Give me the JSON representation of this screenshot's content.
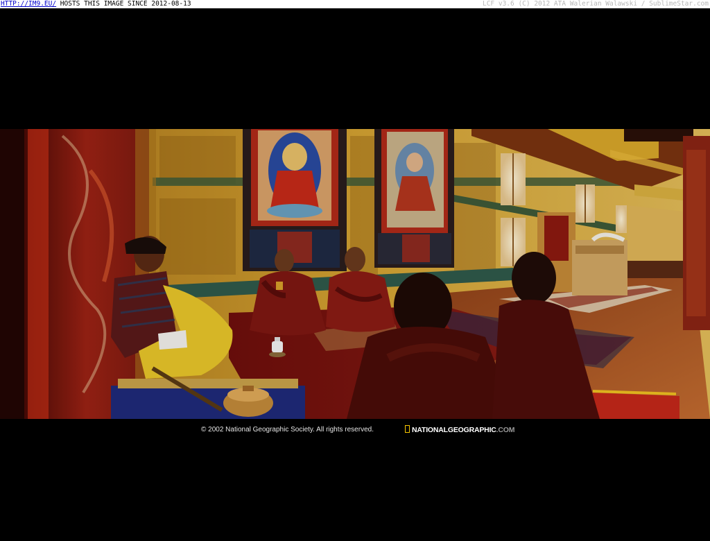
{
  "banner": {
    "link_text": "HTTP://IM9.EU/",
    "hosts_text": " HOSTS THIS IMAGE SINCE 2012-08-13",
    "credit_text": "LCF v3.6 (C) 2012 ATA Walerian Walawski / SublimeStar.com"
  },
  "photo": {
    "scene": "monastery-interior",
    "colors": {
      "wall_gold": "#c9961e",
      "thangka_red": "#8e1a10",
      "robe_maroon": "#7a1712",
      "robe_yellow": "#e8c22a",
      "floor_wood": "#b5622a"
    }
  },
  "caption": {
    "copyright": "© 2002 National Geographic Society. All rights reserved.",
    "brand": "NATIONALGEOGRAPHIC",
    "brand_suffix": ".COM",
    "brand_color": "#f7c600"
  }
}
